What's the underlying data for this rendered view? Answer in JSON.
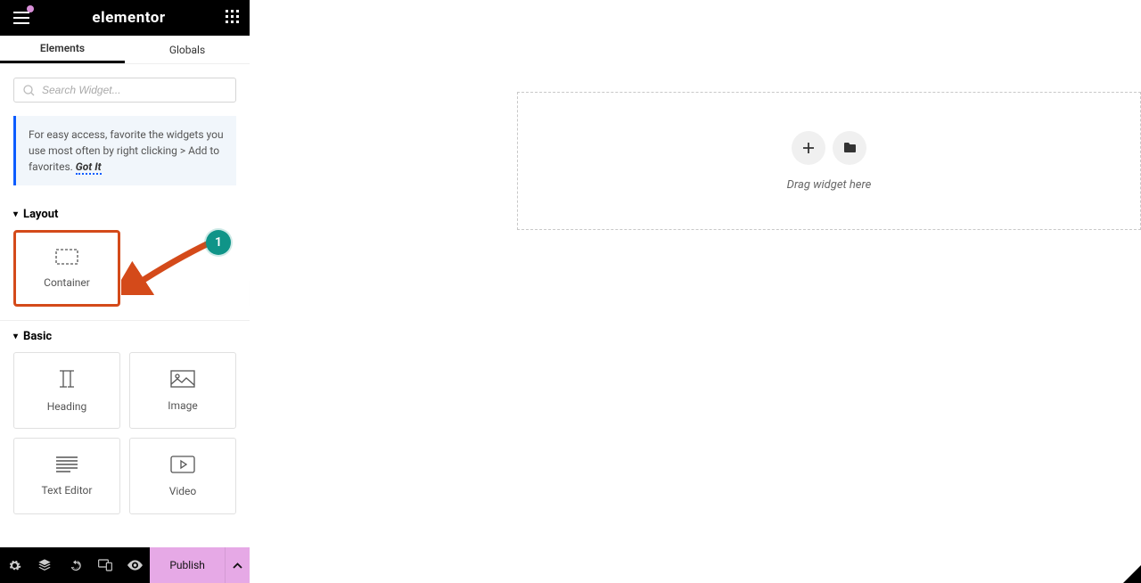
{
  "header": {
    "logo": "elementor"
  },
  "tabs": {
    "elements": "Elements",
    "globals": "Globals"
  },
  "search": {
    "placeholder": "Search Widget..."
  },
  "tip": {
    "text": "For easy access, favorite the widgets you use most often by right clicking > Add to favorites.",
    "got_it": "Got It"
  },
  "categories": {
    "layout": {
      "title": "Layout",
      "items": [
        {
          "label": "Container"
        }
      ]
    },
    "basic": {
      "title": "Basic",
      "items": [
        {
          "label": "Heading"
        },
        {
          "label": "Image"
        },
        {
          "label": "Text Editor"
        },
        {
          "label": "Video"
        }
      ]
    }
  },
  "footer": {
    "publish": "Publish"
  },
  "canvas": {
    "drop_label": "Drag widget here"
  },
  "annotation": {
    "badge": "1"
  }
}
